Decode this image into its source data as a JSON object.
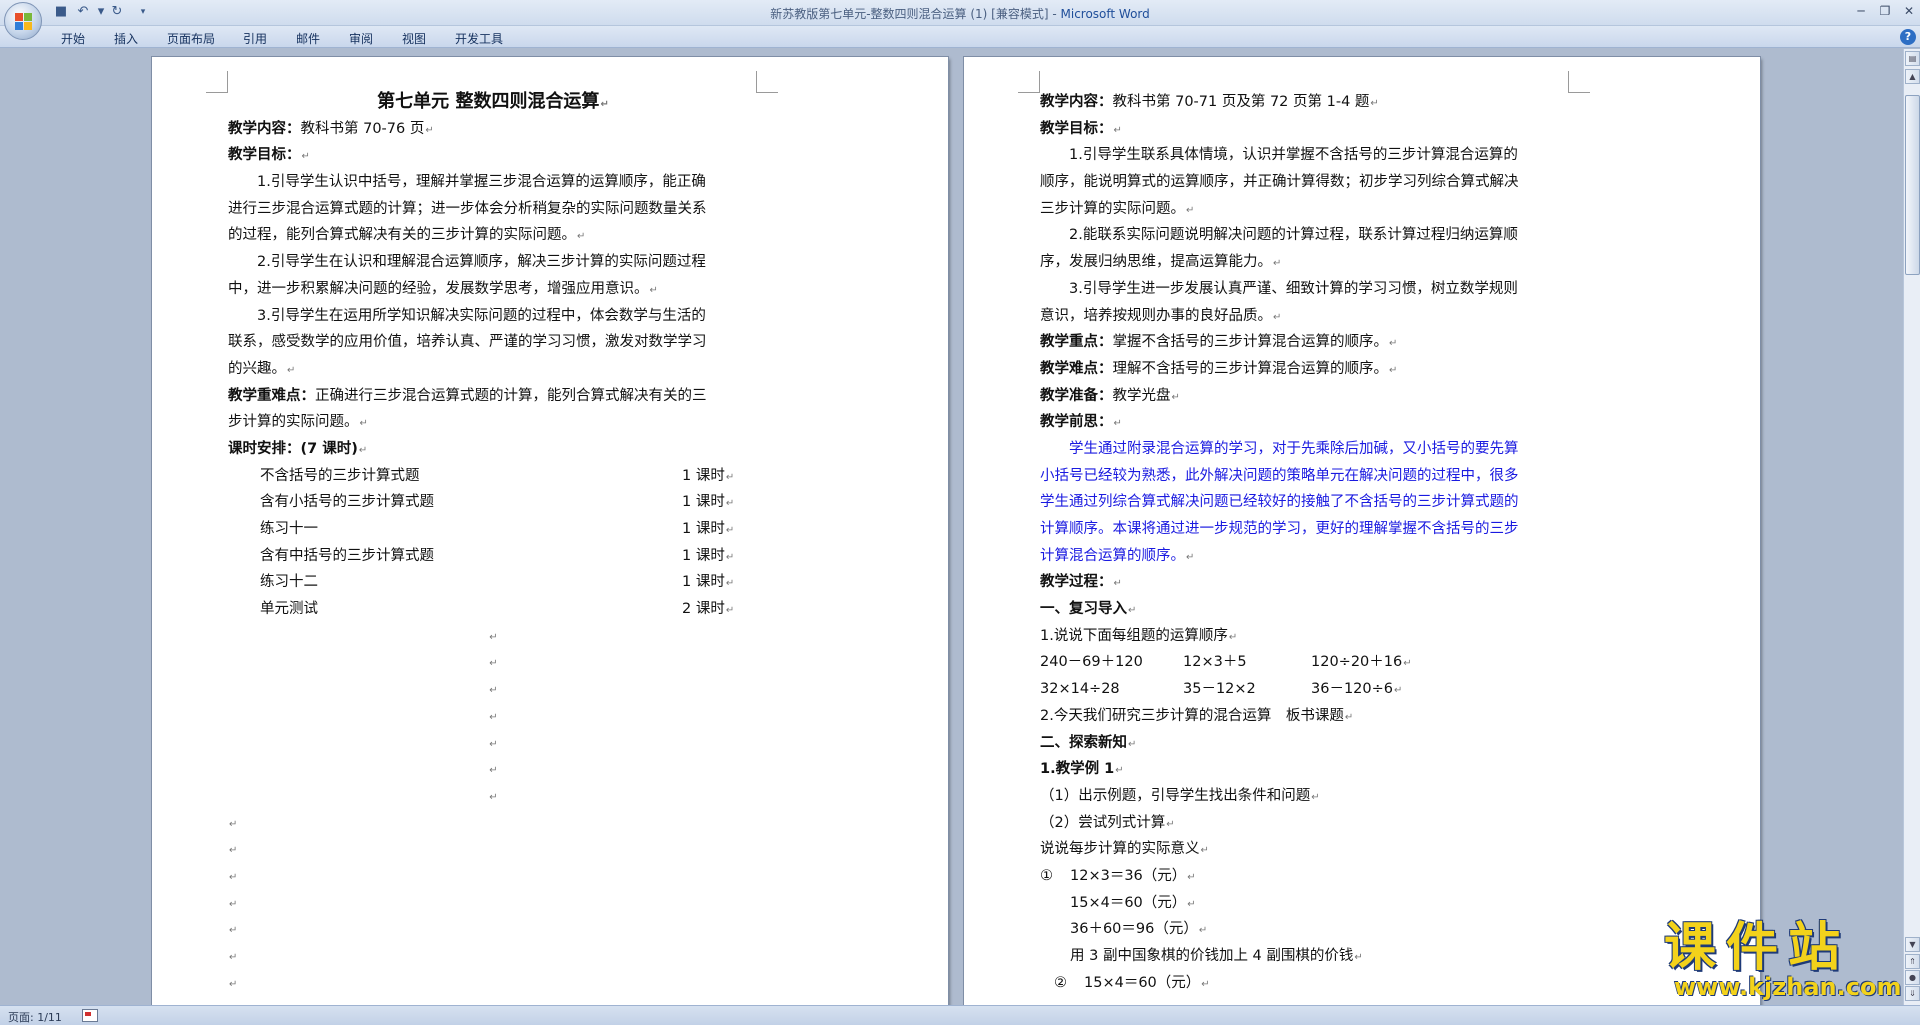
{
  "window": {
    "doc_title": "新苏教版第七单元-整数四则混合运算 (1) [兼容模式] - ",
    "app_name": "Microsoft Word"
  },
  "ribbon": {
    "tabs": [
      "开始",
      "插入",
      "页面布局",
      "引用",
      "邮件",
      "审阅",
      "视图",
      "开发工具"
    ]
  },
  "page1": {
    "title": "第七单元 整数四则混合运算",
    "content_label": "教学内容：",
    "content_text": "教科书第 70-76 页",
    "goals_label": "教学目标：",
    "goal_lines": [
      "1.引导学生认识中括号，理解并掌握三步混合运算的运算顺序，能正确",
      "进行三步混合运算式题的计算；进一步体会分析稍复杂的实际问题数量关系",
      "的过程，能列合算式解决有关的三步计算的实际问题。",
      "2.引导学生在认识和理解混合运算顺序，解决三步计算的实际问题过程",
      "中，进一步积累解决问题的经验，发展数学思考，增强应用意识。",
      "3.引导学生在运用所学知识解决实际问题的过程中，体会数学与生活的",
      "联系，感受数学的应用价值，培养认真、严谨的学习习惯，激发对数学学习",
      "的兴趣。"
    ],
    "difficulty_label": "教学重难点：",
    "difficulty_lines": [
      "正确进行三步混合运算式题的计算，能列合算式解决有关的三",
      "步计算的实际问题。"
    ],
    "schedule_label": "课时安排：(7 课时)",
    "schedule": [
      {
        "name": "不含括号的三步计算式题",
        "hours": "1 课时"
      },
      {
        "name": "含有小括号的三步计算式题",
        "hours": "1 课时"
      },
      {
        "name": "练习十一",
        "hours": "1 课时"
      },
      {
        "name": "含有中括号的三步计算式题",
        "hours": "1 课时"
      },
      {
        "name": "练习十二",
        "hours": "1 课时"
      },
      {
        "name": "单元测试",
        "hours": "2 课时"
      }
    ]
  },
  "page2": {
    "content_label": "教学内容：",
    "content_text": "教科书第 70-71 页及第 72 页第 1-4 题",
    "goals_label": "教学目标：",
    "goal_lines": [
      "1.引导学生联系具体情境，认识并掌握不含括号的三步计算混合运算的",
      "顺序，能说明算式的运算顺序，并正确计算得数；初步学习列综合算式解决",
      "三步计算的实际问题。",
      "2.能联系实际问题说明解决问题的计算过程，联系计算过程归纳运算顺",
      "序，发展归纳思维，提高运算能力。",
      "3.引导学生进一步发展认真严谨、细致计算的学习习惯，树立数学规则",
      "意识，培养按规则办事的良好品质。"
    ],
    "key_label": "教学重点：",
    "key_text": "掌握不含括号的三步计算混合运算的顺序。",
    "hard_label": "教学难点：",
    "hard_text": "理解不含括号的三步计算混合运算的顺序。",
    "prep_label": "教学准备：",
    "prep_text": "教学光盘",
    "pre_label": "教学前思：",
    "pre_lines": [
      "学生通过附录混合运算的学习，对于先乘除后加碱，又小括号的要先算",
      "小括号已经较为熟悉，此外解决问题的策略单元在解决问题的过程中，很多",
      "学生通过列综合算式解决问题已经较好的接触了不含括号的三步计算式题的",
      "计算顺序。本课将通过进一步规范的学习，更好的理解掌握不含括号的三步",
      "计算混合运算的顺序。"
    ],
    "process_label": "教学过程：",
    "review_heading": "一、复习导入",
    "review_q": "1.说说下面每组题的运算顺序",
    "exercises_row1": [
      "240－69＋120",
      "12×3＋5",
      "120÷20＋16"
    ],
    "exercises_row2": [
      "32×14÷28",
      "35－12×2",
      "36－120÷6"
    ],
    "review_q2": "2.今天我们研究三步计算的混合运算　板书课题",
    "explore_heading": "二、探索新知",
    "example_heading": "1.教学例 1",
    "step1": "（1）出示例题，引导学生找出条件和问题",
    "step2": "（2）尝试列式计算",
    "meaning": "说说每步计算的实际意义",
    "calc_num1": "①",
    "calc1": "12×3＝36（元）",
    "calc2": "15×4＝60（元）",
    "calc3": "36＋60＝96（元）",
    "calc_note": "用 3 副中国象棋的价钱加上 4 副围棋的价钱",
    "calc_num2": "②",
    "calc4": "15×4＝60（元）"
  },
  "status": {
    "page_count": "页面: 1/11"
  },
  "watermark": {
    "text": "课件站",
    "url": "www.kjzhan.com"
  },
  "colors": {
    "accent_blue_text": "#1a1ae0",
    "watermark_yellow": "#f3d21b"
  }
}
